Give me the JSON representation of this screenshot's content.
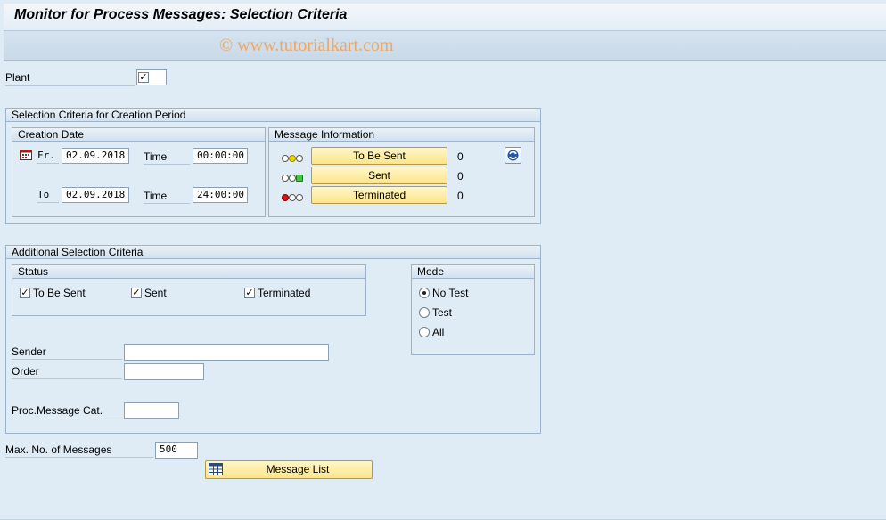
{
  "window": {
    "title": "Monitor for Process Messages: Selection Criteria"
  },
  "watermark": "© www.tutorialkart.com",
  "plant": {
    "label": "Plant",
    "checked": true
  },
  "creation_period": {
    "title": "Selection Criteria for Creation Period",
    "creation_date": {
      "title": "Creation Date",
      "from_label": "Fr.",
      "from_date": "02.09.2018",
      "from_time_label": "Time",
      "from_time": "00:00:00",
      "to_label": "To",
      "to_date": "02.09.2018",
      "to_time_label": "Time",
      "to_time": "24:00:00"
    },
    "message_info": {
      "title": "Message Information",
      "rows": [
        {
          "label": "To Be Sent",
          "count": "0",
          "status": "yellow"
        },
        {
          "label": "Sent",
          "count": "0",
          "status": "green"
        },
        {
          "label": "Terminated",
          "count": "0",
          "status": "red"
        }
      ]
    }
  },
  "additional": {
    "title": "Additional Selection Criteria",
    "status": {
      "title": "Status",
      "items": [
        {
          "label": "To Be Sent",
          "checked": true
        },
        {
          "label": "Sent",
          "checked": true
        },
        {
          "label": "Terminated",
          "checked": true
        }
      ]
    },
    "mode": {
      "title": "Mode",
      "options": [
        {
          "label": "No Test",
          "selected": true
        },
        {
          "label": "Test",
          "selected": false
        },
        {
          "label": "All",
          "selected": false
        }
      ]
    },
    "sender_label": "Sender",
    "sender_value": "",
    "order_label": "Order",
    "order_value": "",
    "proc_label": "Proc.Message Cat.",
    "proc_value": ""
  },
  "max_messages": {
    "label": "Max. No. of Messages",
    "value": "500"
  },
  "message_list_button": "Message List",
  "colors": {
    "yellow": "#f3d000",
    "green": "#3cc83c",
    "red": "#e01010",
    "button": "#fde58a"
  }
}
